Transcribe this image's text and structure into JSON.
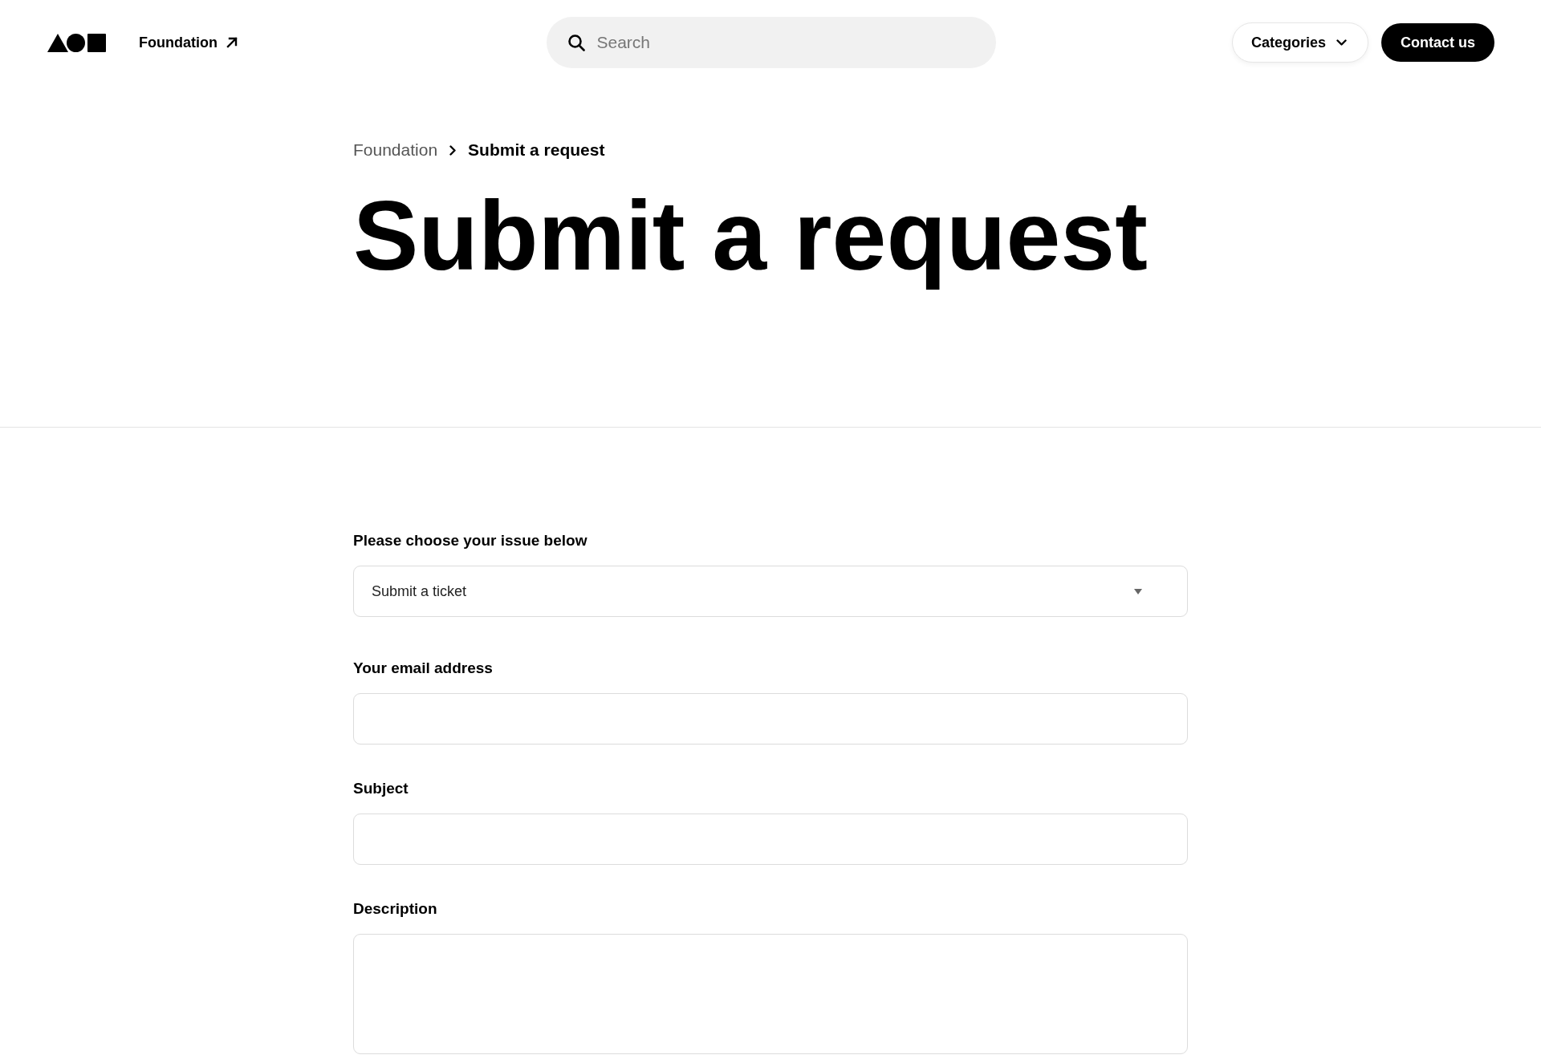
{
  "header": {
    "site_link": {
      "label": "Foundation"
    },
    "search": {
      "placeholder": "Search"
    },
    "categories_button": {
      "label": "Categories"
    },
    "contact_button": {
      "label": "Contact us"
    }
  },
  "breadcrumb": [
    {
      "label": "Foundation",
      "current": false
    },
    {
      "label": "Submit a request",
      "current": true
    }
  ],
  "page_title": "Submit a request",
  "form": {
    "fields": [
      {
        "kind": "select",
        "label": "Please choose your issue below",
        "value": "Submit a ticket"
      },
      {
        "kind": "text",
        "label": "Your email address"
      },
      {
        "kind": "text",
        "label": "Subject"
      },
      {
        "kind": "textarea",
        "label": "Description"
      }
    ]
  }
}
